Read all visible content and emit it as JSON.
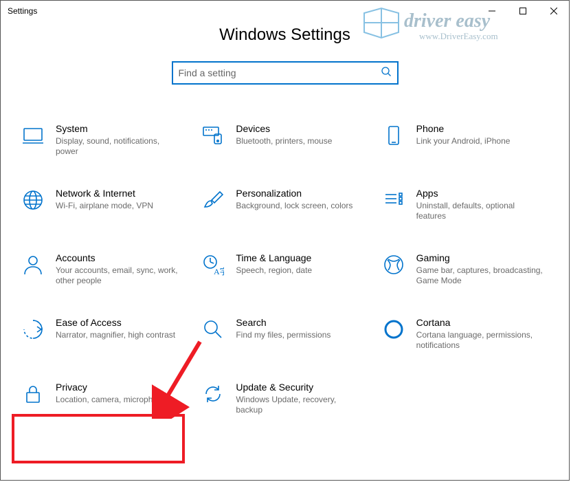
{
  "window": {
    "title": "Settings"
  },
  "page": {
    "title": "Windows Settings"
  },
  "search": {
    "placeholder": "Find a setting"
  },
  "items": [
    {
      "title": "System",
      "desc": "Display, sound, notifications, power"
    },
    {
      "title": "Devices",
      "desc": "Bluetooth, printers, mouse"
    },
    {
      "title": "Phone",
      "desc": "Link your Android, iPhone"
    },
    {
      "title": "Network & Internet",
      "desc": "Wi-Fi, airplane mode, VPN"
    },
    {
      "title": "Personalization",
      "desc": "Background, lock screen, colors"
    },
    {
      "title": "Apps",
      "desc": "Uninstall, defaults, optional features"
    },
    {
      "title": "Accounts",
      "desc": "Your accounts, email, sync, work, other people"
    },
    {
      "title": "Time & Language",
      "desc": "Speech, region, date"
    },
    {
      "title": "Gaming",
      "desc": "Game bar, captures, broadcasting, Game Mode"
    },
    {
      "title": "Ease of Access",
      "desc": "Narrator, magnifier, high contrast"
    },
    {
      "title": "Search",
      "desc": "Find my files, permissions"
    },
    {
      "title": "Cortana",
      "desc": "Cortana language, permissions, notifications"
    },
    {
      "title": "Privacy",
      "desc": "Location, camera, microphone"
    },
    {
      "title": "Update & Security",
      "desc": "Windows Update, recovery, backup"
    }
  ],
  "watermark": {
    "brand": "driver easy",
    "url": "www.DriverEasy.com"
  }
}
